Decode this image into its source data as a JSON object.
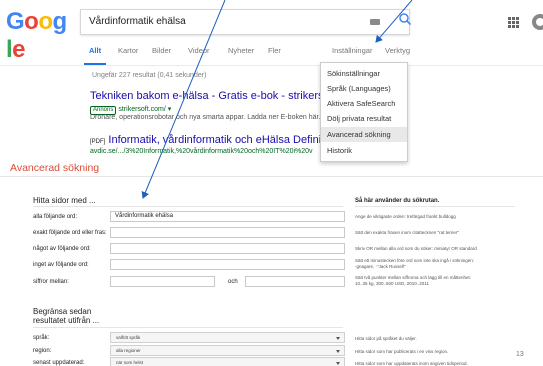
{
  "google": {
    "logo": [
      "G",
      "o",
      "o",
      "g",
      "l",
      "e"
    ],
    "logo_colors": [
      "#4285f4",
      "#ea4335",
      "#fbbc05",
      "#4285f4",
      "#34a853",
      "#ea4335"
    ],
    "query": "Vårdinformatik ehälsa"
  },
  "tabs": [
    "Allt",
    "Kartor",
    "Bilder",
    "Videor",
    "Nyheter",
    "Fler",
    "Inställningar",
    "Verktyg"
  ],
  "results": {
    "count": "Ungefär 227 resultat (0,41 sekunder)",
    "r1_title": "Tekniken bakom e-hälsa - Gratis e-bok - strikersoft.com",
    "r1_ad": "Annons",
    "r1_url": "strikersoft.com/ ▾",
    "r1_snippet": "Drönare, operationsrobotar och nya smarta appar. Ladda ner E-boken här.",
    "r2_prefix": "[PDF]",
    "r2_title": "Informatik, vårdinformatik och eHälsa Definition infor",
    "r2_url": "avdic.se/.../3%20Informatik,%20vårdinformatik%20och%20IT%20i%20v"
  },
  "settings_menu": [
    "Sökinställningar",
    "Språk (Languages)",
    "Aktivera SafeSearch",
    "Dölj privata resultat",
    "Avancerad sökning",
    "Historik"
  ],
  "advanced": {
    "title": "Avancerad sökning",
    "find_header": "Hitta sidor med ...",
    "howto_header": "Så här använder du sökrutan.",
    "rows": [
      {
        "label": "alla följande ord:",
        "value": "Vårdinformatik ehälsa",
        "hint": "Ange de viktigaste orden: trefärgad frankt bulldogg"
      },
      {
        "label": "exakt följande ord eller fras:",
        "value": "",
        "hint": "Sätt den exakta frasen inom citattecknen \"rat terrier\""
      },
      {
        "label": "något av följande ord:",
        "value": "",
        "hint": "Skriv OR mellan alla ord som du söker: miniatyr OR standard"
      },
      {
        "label": "inget av följande ord:",
        "value": "",
        "hint_lines": [
          "Sätt ett minustecken före ord som inte ska ingå i sökningen:",
          "-gnagare, -\"Jack Russell\""
        ]
      },
      {
        "label": "siffror mellan:",
        "value": "",
        "and_label": "och",
        "hint_lines": [
          "Sätt två punkter mellan siffrorna och lägg till en måttenhet:",
          "10..35 kg, 300..500 USD, 2010..2011"
        ]
      }
    ],
    "narrow_header_lines": [
      "Begränsa sedan",
      "resultatet utifrån ..."
    ],
    "narrow_rows": [
      {
        "label": "språk:",
        "value": "valfritt språk",
        "hint": "Hitta sidor på språket du väljer."
      },
      {
        "label": "region:",
        "value": "alla regioner",
        "hint": "Hitta sidor som har publicerats i en viss region."
      },
      {
        "label": "senast uppdaterad:",
        "value": "när som helst",
        "hint": "Hitta sidor som har uppdaterats inom angiven tidsperiod."
      }
    ]
  },
  "page_number": "13",
  "colors": {
    "accent_blue": "#1a73e8",
    "link_blue": "#1a0dab",
    "url_green": "#006621",
    "title_red": "#dd4b39",
    "arrow_blue": "#1f5fbf"
  }
}
